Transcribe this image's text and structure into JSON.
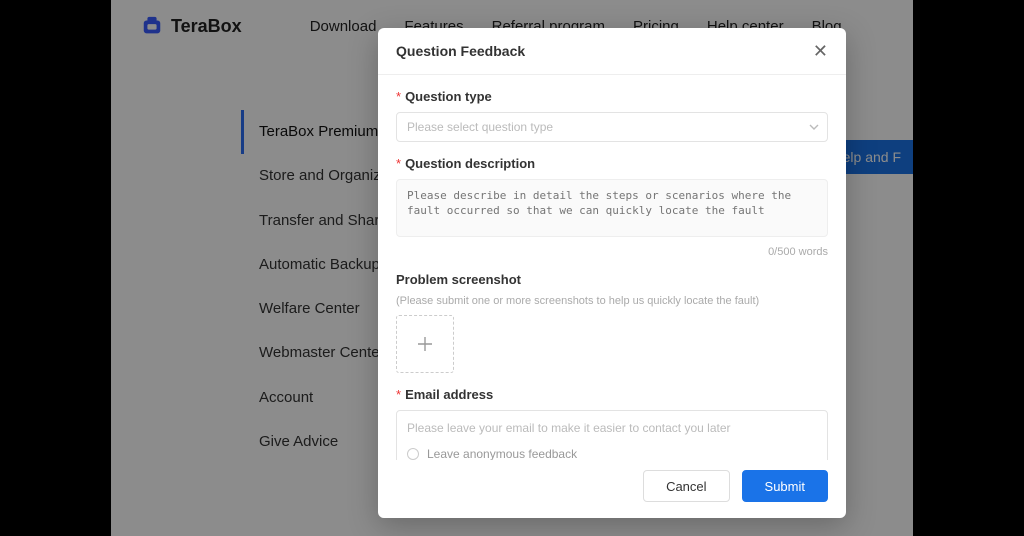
{
  "brand": {
    "name": "TeraBox"
  },
  "nav": {
    "items": [
      "Download",
      "Features",
      "Referral program",
      "Pricing",
      "Help center",
      "Blog"
    ]
  },
  "sidebar": {
    "items": [
      "TeraBox Premium",
      "Store and Organize",
      "Transfer and Share",
      "Automatic Backup",
      "Welfare Center",
      "Webmaster Center",
      "Account",
      "Give Advice"
    ],
    "active_index": 0
  },
  "help_button": {
    "label": "Help and F"
  },
  "modal": {
    "title": "Question Feedback",
    "qtype": {
      "label": "Question type",
      "placeholder": "Please select question type"
    },
    "qdesc": {
      "label": "Question description",
      "placeholder": "Please describe in detail the steps or scenarios where the fault occurred so that we can quickly locate the fault",
      "counter": "0/500 words"
    },
    "screenshot": {
      "label": "Problem screenshot",
      "hint": "(Please submit one or more screenshots to help us quickly locate the fault)"
    },
    "email": {
      "label": "Email address",
      "placeholder": "Please leave your email to make it easier to contact you later",
      "anon_label": "Leave anonymous feedback"
    },
    "buttons": {
      "cancel": "Cancel",
      "submit": "Submit"
    }
  }
}
